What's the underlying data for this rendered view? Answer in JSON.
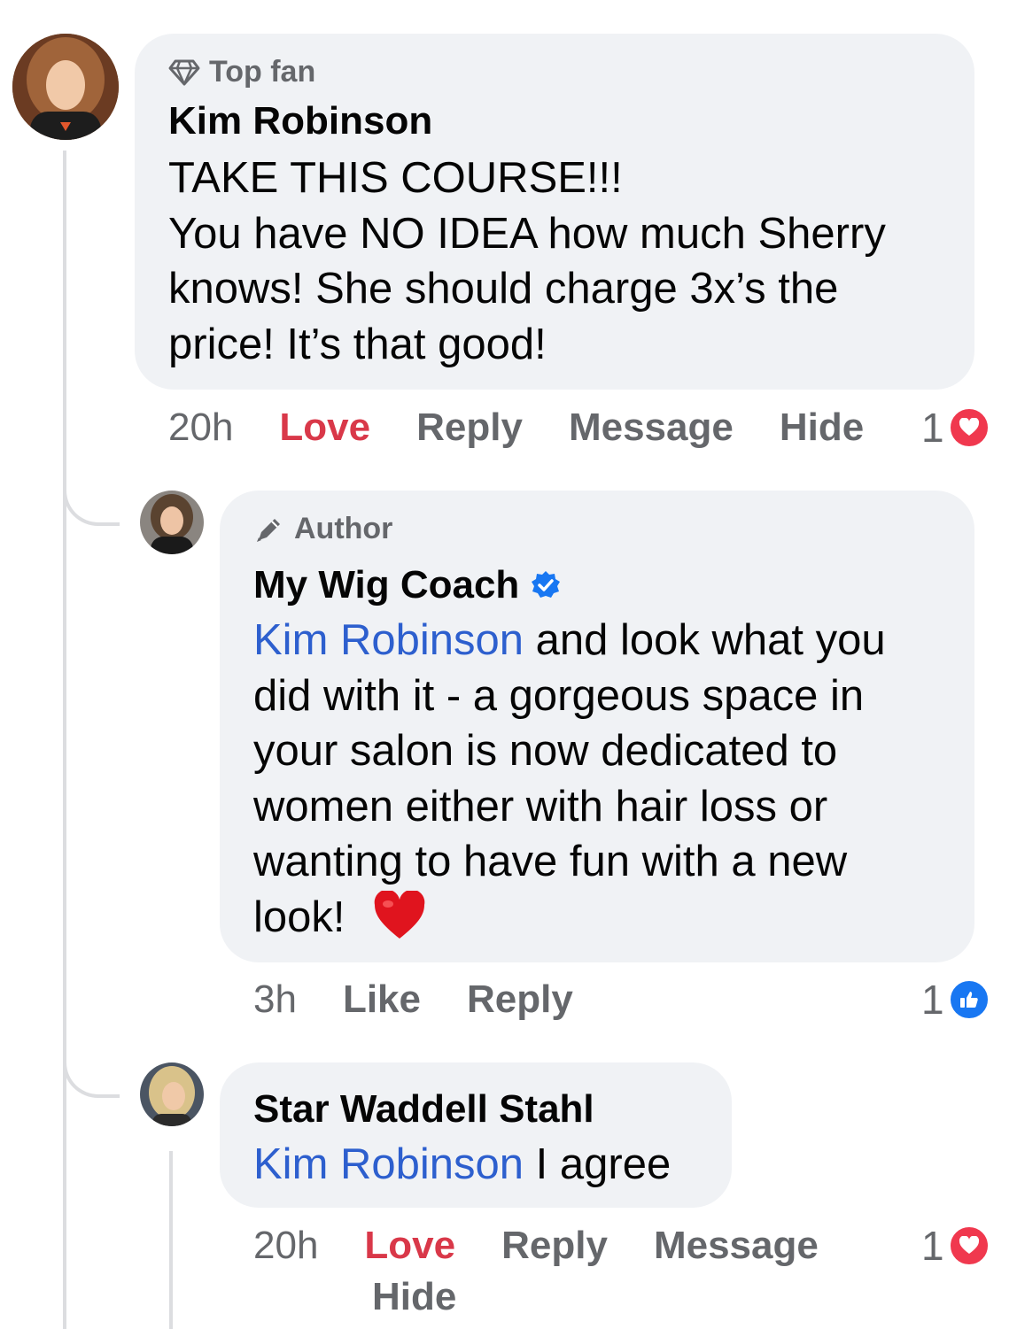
{
  "comments": [
    {
      "badge": "Top fan",
      "author": "Kim Robinson",
      "lines": [
        "TAKE THIS COURSE!!!",
        "You have NO IDEA how much Sherry",
        "knows! She should charge 3x’s the",
        "price! It’s that good!"
      ],
      "time": "20h",
      "actions": [
        "Love",
        "Reply",
        "Message",
        "Hide"
      ],
      "reaction_count": "1",
      "reaction_type": "love-icon"
    },
    {
      "badge": "Author",
      "author": "My Wig Coach",
      "mention": "Kim Robinson",
      "lines": [
        " and look what you",
        "did with it - a gorgeous space in",
        "your salon is now dedicated to",
        "women either with hair loss or",
        "wanting to have fun with a new",
        "look! "
      ],
      "emoji": "❤️",
      "time": "3h",
      "actions": [
        "Like",
        "Reply"
      ],
      "reaction_count": "1",
      "reaction_type": "like-icon"
    },
    {
      "author": "Star Waddell Stahl",
      "mention": "Kim Robinson",
      "text": " I agree",
      "time": "20h",
      "actions": [
        "Love",
        "Reply",
        "Message",
        "Hide"
      ],
      "reaction_count": "1",
      "reaction_type": "love-icon"
    }
  ],
  "colors": {
    "mention": "#2d5fce",
    "love": "#d93849",
    "like": "#1877f2",
    "bubble": "#f0f2f5"
  }
}
